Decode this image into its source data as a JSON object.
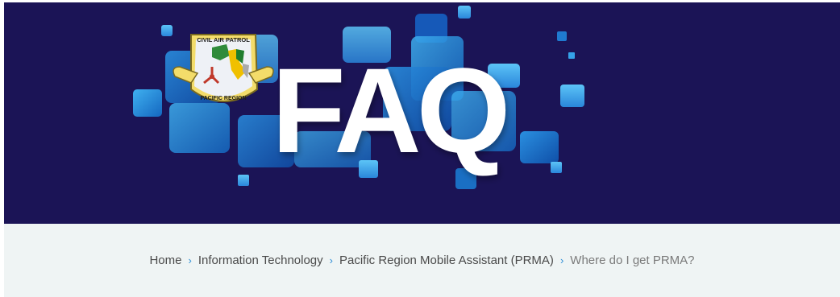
{
  "hero": {
    "banner_text": "FAQ",
    "emblem": {
      "top_text": "CIVIL AIR PATROL",
      "bottom_text": "PACIFIC REGION"
    },
    "colors": {
      "background": "#1b1456",
      "tile_light": "#35a2e8",
      "tile_dark": "#1a6fc4",
      "text": "#ffffff"
    }
  },
  "breadcrumb": {
    "items": [
      {
        "label": "Home"
      },
      {
        "label": "Information Technology"
      },
      {
        "label": "Pacific Region Mobile Assistant (PRMA)"
      }
    ],
    "separator": "›",
    "current": "Where do I get PRMA?"
  }
}
